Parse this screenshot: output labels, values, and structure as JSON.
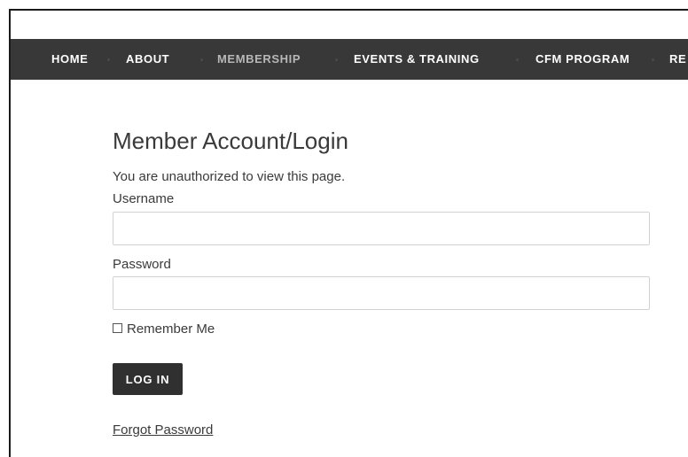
{
  "nav": {
    "items": [
      {
        "label": "HOME",
        "active": false
      },
      {
        "label": "ABOUT",
        "active": false
      },
      {
        "label": "MEMBERSHIP",
        "active": true
      },
      {
        "label": "EVENTS & TRAINING",
        "active": false
      },
      {
        "label": "CFM PROGRAM",
        "active": false
      },
      {
        "label": "RE",
        "active": false
      }
    ]
  },
  "login": {
    "title": "Member Account/Login",
    "message": "You are unauthorized to view this page.",
    "username_label": "Username",
    "username_value": "",
    "password_label": "Password",
    "password_value": "",
    "remember_label": "Remember Me",
    "remember_checked": false,
    "submit_label": "LOG IN",
    "forgot_label": "Forgot Password"
  },
  "colors": {
    "navbar_bg": "#383838",
    "nav_text": "#ffffff",
    "nav_active_text": "#b7b7b7",
    "button_bg": "#303030",
    "body_text": "#3a3a3a"
  }
}
